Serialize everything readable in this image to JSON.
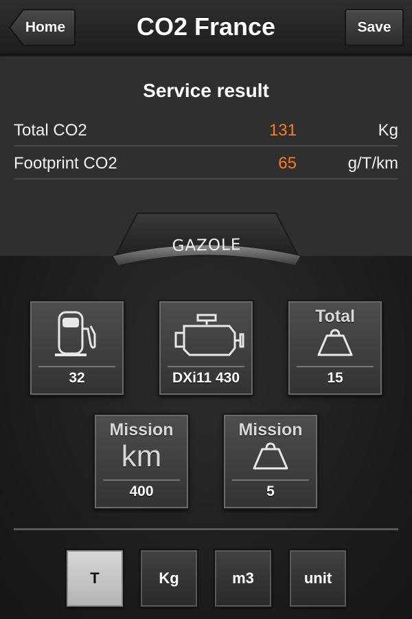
{
  "nav": {
    "title": "CO2 France",
    "home_label": "Home",
    "save_label": "Save"
  },
  "result": {
    "title": "Service result",
    "rows": [
      {
        "label": "Total CO2",
        "value": "131",
        "unit": "Kg"
      },
      {
        "label": "Footprint CO2",
        "value": "65",
        "unit": "g/T/km"
      }
    ]
  },
  "fuel": {
    "label": "GAZOLE"
  },
  "tiles": {
    "fuel": {
      "icon": "fuel-pump-icon",
      "value": "32"
    },
    "engine": {
      "icon": "engine-icon",
      "value": "DXi11 430"
    },
    "total_weight": {
      "header": "Total",
      "icon": "weight-icon",
      "value": "15"
    },
    "mission_km": {
      "header": "Mission",
      "big": "km",
      "value": "400"
    },
    "mission_weight": {
      "header": "Mission",
      "icon": "weight-icon",
      "value": "5"
    }
  },
  "units": {
    "options": [
      "T",
      "Kg",
      "m3",
      "unit"
    ],
    "selected": "T"
  },
  "colors": {
    "accent_value": "#ff7a1a"
  }
}
